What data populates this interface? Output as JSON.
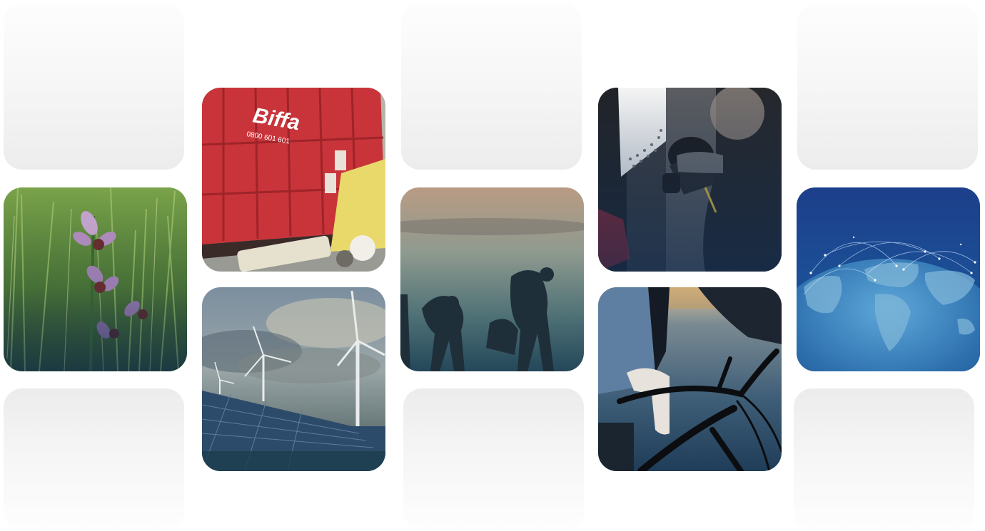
{
  "gallery": {
    "tiles": [
      {
        "id": "orchid-meadow",
        "subject": "bee orchid flowers in grass"
      },
      {
        "id": "skip-container",
        "subject": "red waste skip container with litter",
        "brand_text": "Biffa",
        "phone_text": "0800 601 601"
      },
      {
        "id": "wind-solar",
        "subject": "wind turbines and solar panels under cloudy sky"
      },
      {
        "id": "litter-pickers",
        "subject": "silhouetted people picking up litter in mist"
      },
      {
        "id": "ev-charging",
        "subject": "person plugging charger into electric vehicle"
      },
      {
        "id": "bike-commuter",
        "subject": "person in suit riding a bicycle"
      },
      {
        "id": "globe-network",
        "subject": "earth globe with network connections"
      }
    ]
  },
  "colors": {
    "overlay_navy": "#0f2d55",
    "skip_red": "#c8343a",
    "globe_blue": "#1b4f96"
  }
}
